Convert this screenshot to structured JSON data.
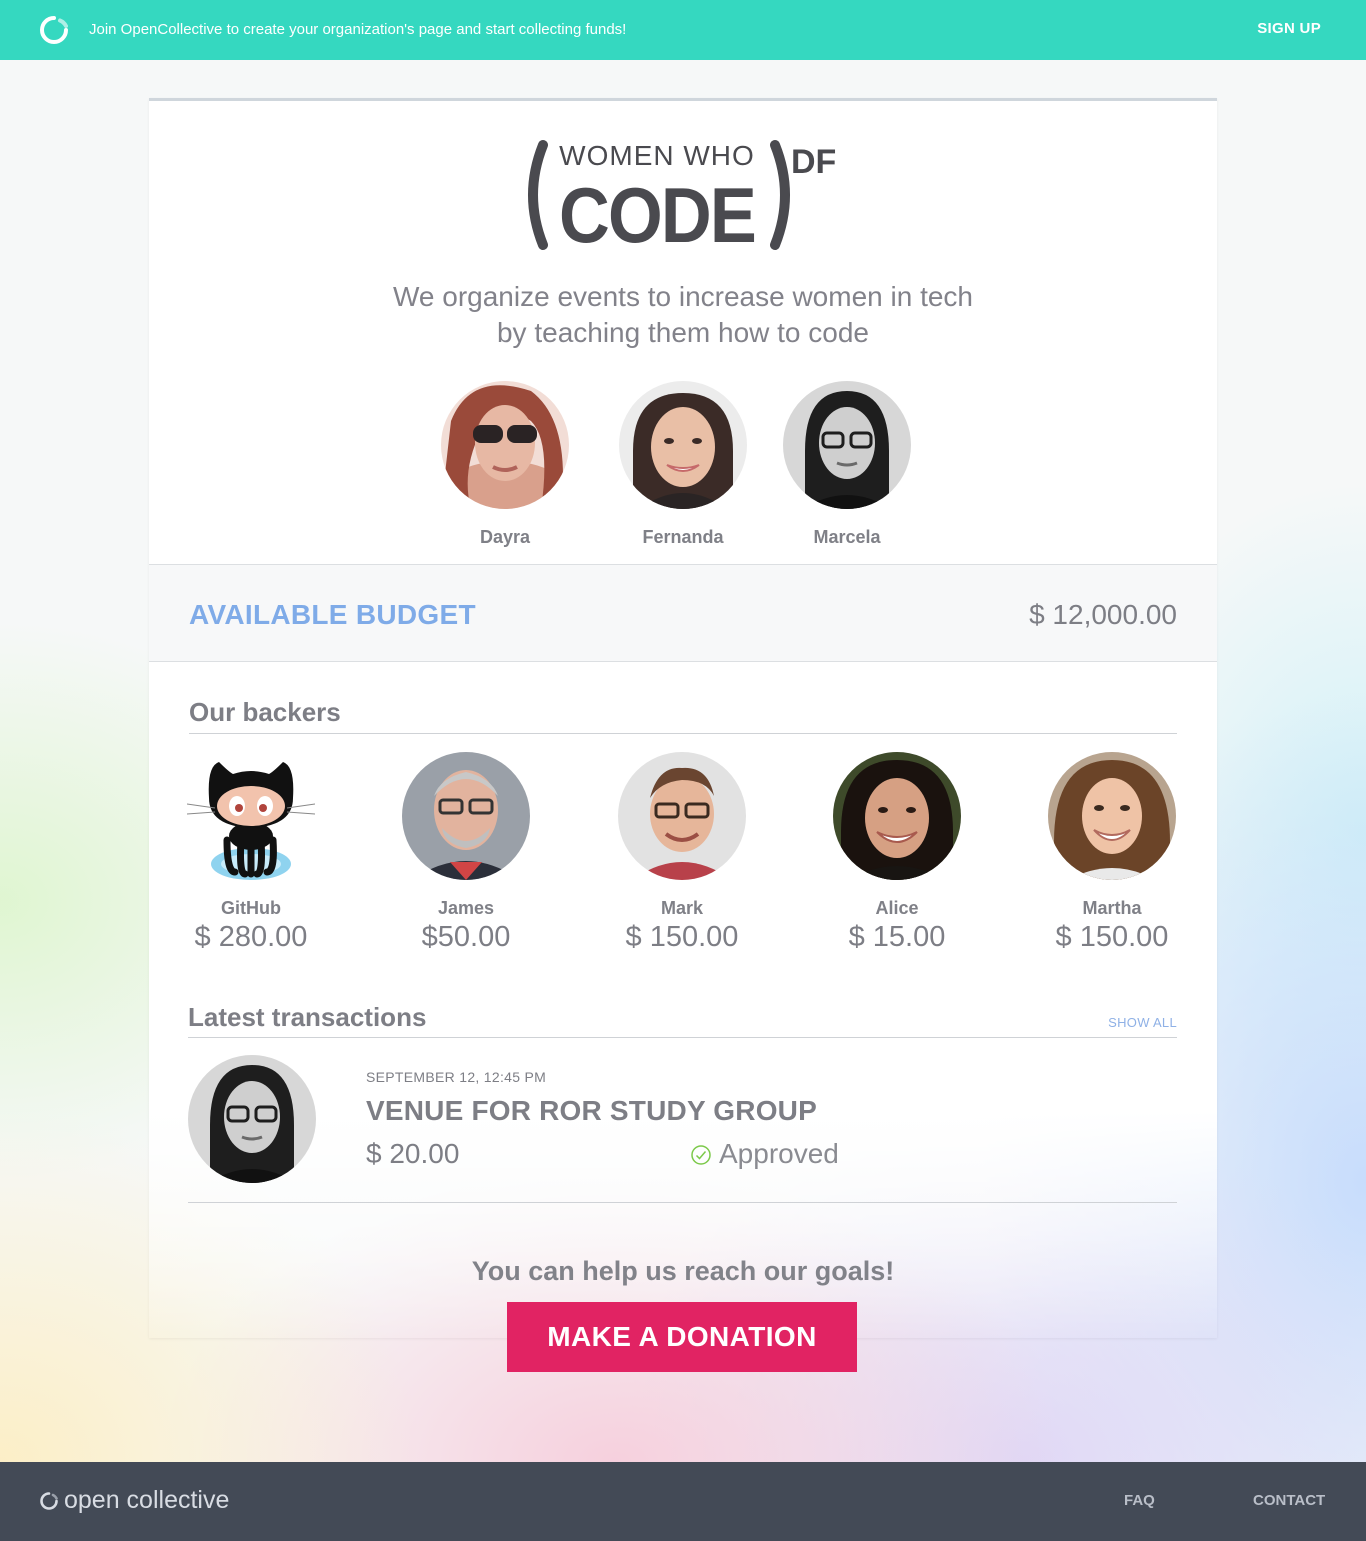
{
  "topbar": {
    "promo_text": "Join OpenCollective to create your organization's page and start collecting funds!",
    "signup_label": "SIGN UP",
    "color": "#35d8c0"
  },
  "organization": {
    "logo_text": "WOMEN WHO CODE DF",
    "logo_top": "WOMEN WHO",
    "logo_main": "CODE",
    "logo_suffix": "DF",
    "tagline_line1": "We organize events to increase women in tech",
    "tagline_line2": "by teaching them how to code"
  },
  "members": [
    {
      "name": "Dayra"
    },
    {
      "name": "Fernanda"
    },
    {
      "name": "Marcela"
    }
  ],
  "budget": {
    "label": "AVAILABLE BUDGET",
    "amount": "$ 12,000.00",
    "label_color": "#7fabe8"
  },
  "backers_section": {
    "title": "Our backers",
    "backers": [
      {
        "name": "GitHub",
        "amount": "$ 280.00",
        "icon": "octocat-icon"
      },
      {
        "name": "James",
        "amount": "$50.00"
      },
      {
        "name": "Mark",
        "amount": "$ 150.00"
      },
      {
        "name": "Alice",
        "amount": "$ 15.00"
      },
      {
        "name": "Martha",
        "amount": "$ 150.00"
      }
    ]
  },
  "transactions_section": {
    "title": "Latest transactions",
    "show_all_label": "SHOW ALL",
    "items": [
      {
        "date": "SEPTEMBER 12, 12:45 PM",
        "title": "VENUE FOR ROR STUDY GROUP",
        "amount": "$ 20.00",
        "status": "Approved",
        "status_icon": "check-circle-icon"
      }
    ]
  },
  "cta": {
    "text": "You can help us reach our goals!",
    "button_label": "MAKE A DONATION",
    "button_color": "#e12363"
  },
  "footer": {
    "brand": "open collective",
    "links": [
      "FAQ",
      "CONTACT"
    ]
  }
}
